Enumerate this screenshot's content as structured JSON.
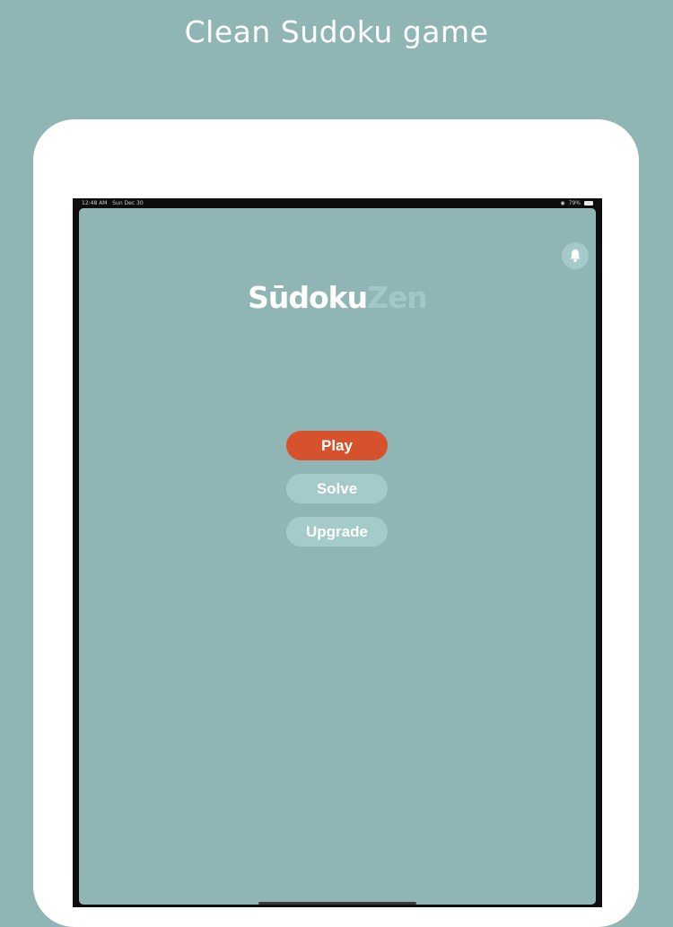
{
  "marketing": {
    "headline": "Clean Sudoku game"
  },
  "statusbar": {
    "time": "12:48 AM",
    "date": "Sun Dec 30",
    "battery": "79%",
    "wifi_icon": "wifi-icon",
    "battery_icon": "battery-icon"
  },
  "app": {
    "logo_part1": "Sūdoku",
    "logo_part2": "Zen",
    "bell_icon": "bell-icon",
    "menu": {
      "play_label": "Play",
      "solve_label": "Solve",
      "upgrade_label": "Upgrade"
    }
  },
  "colors": {
    "background": "#8fb5b4",
    "primary_button": "#d6522c",
    "secondary_button": "#a4cac9",
    "logo_accent": "#a1c8c7"
  }
}
